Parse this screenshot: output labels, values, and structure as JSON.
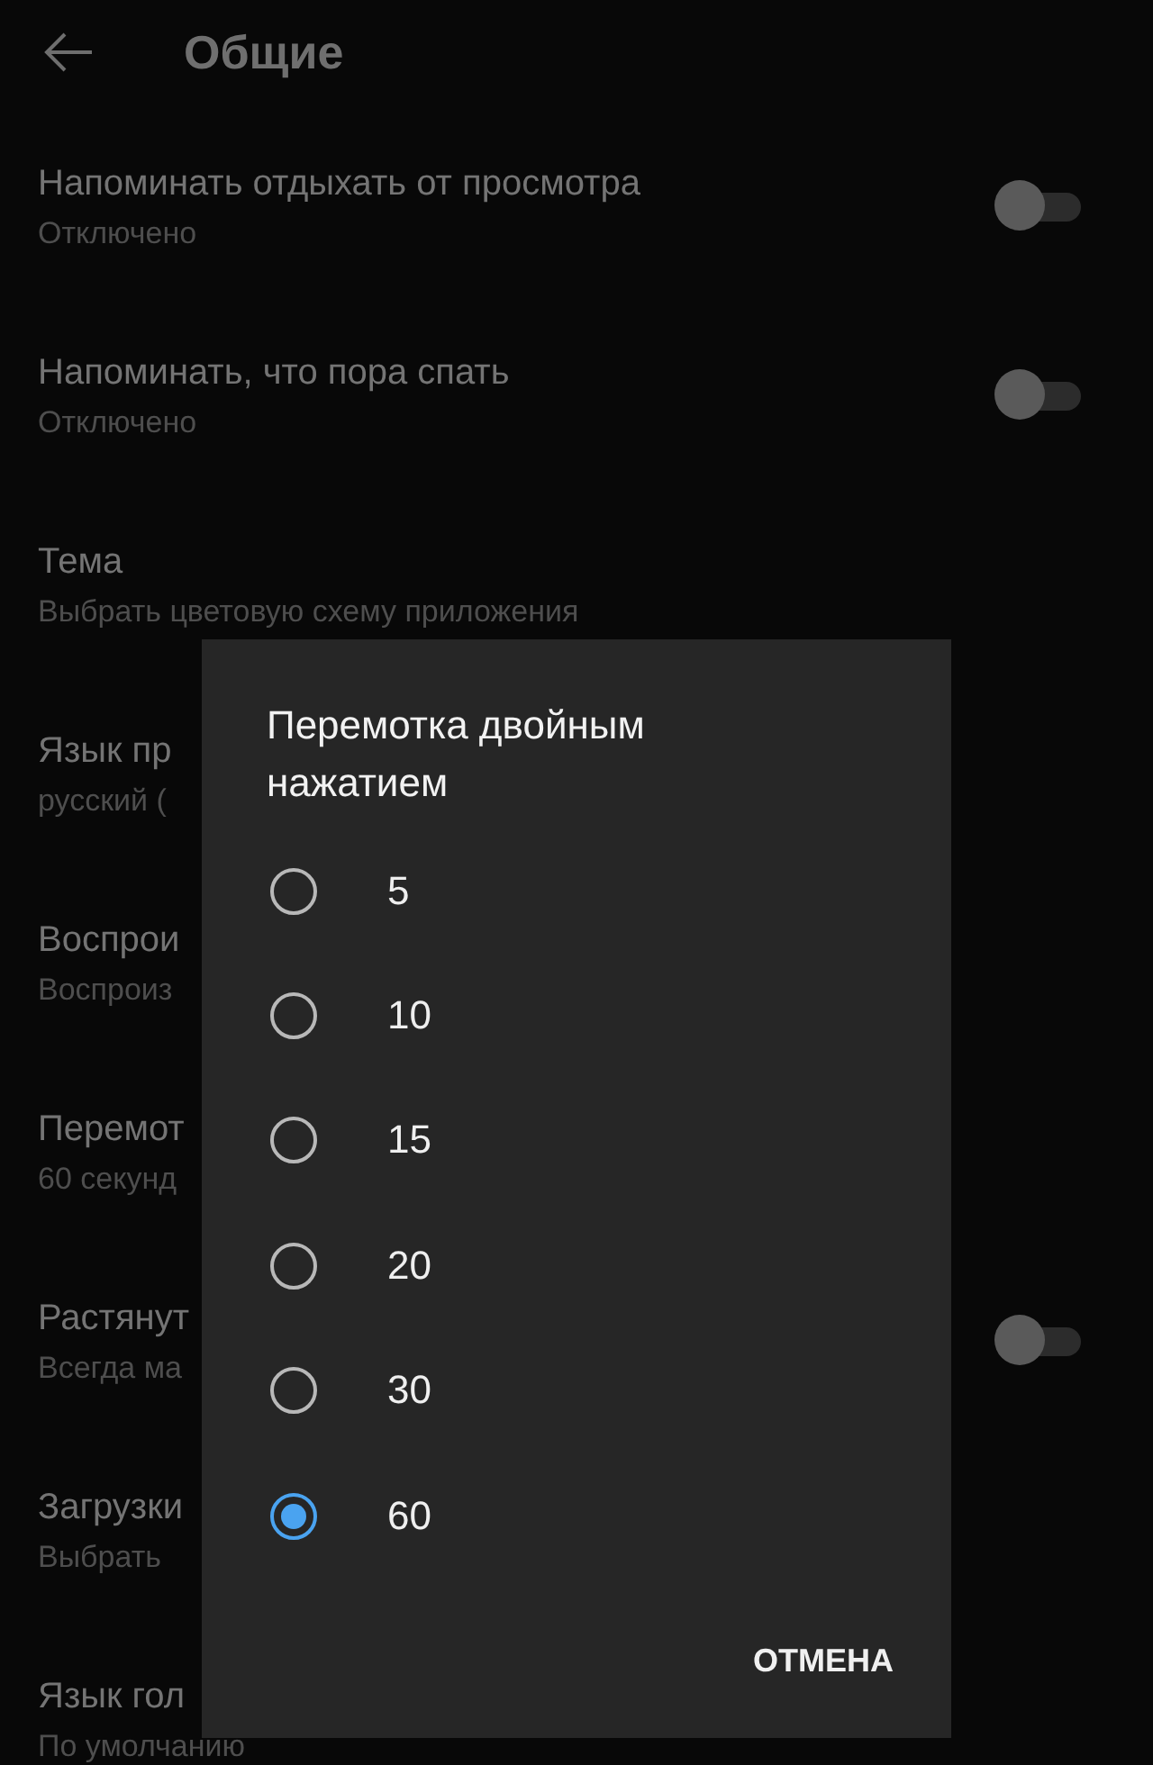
{
  "header": {
    "title": "Общие"
  },
  "settings": [
    {
      "kind": "toggle",
      "title": "Напоминать отдыхать от просмотра",
      "subtitle": "Отключено",
      "on": false
    },
    {
      "kind": "toggle",
      "title": "Напоминать, что пора спать",
      "subtitle": "Отключено",
      "on": false
    },
    {
      "kind": "plain",
      "title": "Тема",
      "subtitle": "Выбрать цветовую схему приложения"
    },
    {
      "kind": "plain",
      "title": "Язык пр",
      "subtitle": "русский ("
    },
    {
      "kind": "plain",
      "title": "Воспрои",
      "subtitle": "Воспроиз"
    },
    {
      "kind": "plain",
      "title": "Перемот",
      "subtitle": "60 секунд"
    },
    {
      "kind": "toggle",
      "title": "Растянут",
      "subtitle": "Всегда ма",
      "on": false
    },
    {
      "kind": "plain",
      "title": "Загрузки",
      "subtitle": "Выбрать"
    },
    {
      "kind": "plain",
      "title": "Язык гол",
      "subtitle": "По умолчанию"
    }
  ],
  "dialog": {
    "title": "Перемотка двойным нажатием",
    "options": [
      {
        "label": "5",
        "selected": false
      },
      {
        "label": "10",
        "selected": false
      },
      {
        "label": "15",
        "selected": false
      },
      {
        "label": "20",
        "selected": false
      },
      {
        "label": "30",
        "selected": false
      },
      {
        "label": "60",
        "selected": true
      }
    ],
    "cancel_button": "ОТМЕНА"
  }
}
